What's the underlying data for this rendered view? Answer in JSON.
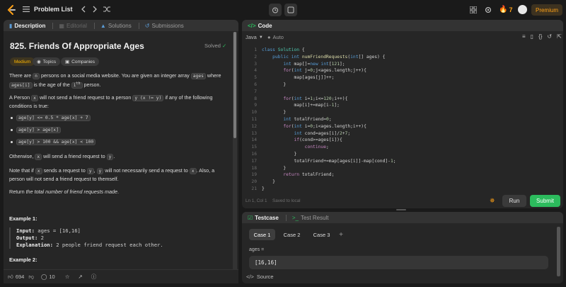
{
  "header": {
    "problem_list": "Problem List",
    "streak": "7",
    "premium": "Premium"
  },
  "left_tabs": {
    "description": "Description",
    "editorial": "Editorial",
    "solutions": "Solutions",
    "submissions": "Submissions"
  },
  "problem": {
    "title": "825. Friends Of Appropriate Ages",
    "solved": "Solved",
    "tags": {
      "difficulty": "Medium",
      "topics": "Topics",
      "companies": "Companies"
    },
    "p1": {
      "a": "There are",
      "n": "n",
      "b": "persons on a social media website. You are given an integer array",
      "ages": "ages",
      "c": "where",
      "agesi": "ages[i]",
      "d": "is the age of the",
      "sup_i": "i",
      "sup_th": "th",
      "e": "person."
    },
    "p2": {
      "a": "A Person",
      "x": "x",
      "b": "will not send a friend request to a person",
      "cond": "y (x != y)",
      "c": "if any of the following conditions is true:"
    },
    "conditions": [
      "age[y] <= 0.5 * age[x] + 7",
      "age[y] > age[x]",
      "age[y] > 100 && age[x] < 100"
    ],
    "p3": {
      "a": "Otherwise,",
      "x": "x",
      "b": "will send a friend request to",
      "y": "y",
      "c": "."
    },
    "p4": {
      "a": "Note that if",
      "x": "x",
      "b": "sends a request to",
      "y": "y",
      "c": ",",
      "y2": "y",
      "d": "will not necessarily send a request to",
      "x2": "x",
      "e": ". Also, a person will not send a friend request to themself."
    },
    "p5": {
      "a": "Return",
      "b": "the total number of friend requests made",
      "c": "."
    },
    "example1": {
      "head": "Example 1:",
      "input_k": "Input:",
      "input_v": "ages = [16,16]",
      "output_k": "Output:",
      "output_v": "2",
      "expl_k": "Explanation:",
      "expl_v": "2 people friend request each other."
    },
    "example2": {
      "head": "Example 2:"
    }
  },
  "left_footer": {
    "likes": "694",
    "comments": "10"
  },
  "code": {
    "tab": "Code",
    "lang": "Java",
    "auto": "Auto",
    "status_pos": "Ln 1, Col 1",
    "status_saved": "Saved to local",
    "run": "Run",
    "submit": "Submit",
    "lines": [
      "1",
      "2",
      "3",
      "4",
      "5",
      "6",
      "7",
      "8",
      "9",
      "10",
      "11",
      "12",
      "13",
      "14",
      "15",
      "16",
      "17",
      "18",
      "19",
      "20",
      "21"
    ]
  },
  "testcase": {
    "tab": "Testcase",
    "result_tab": "Test Result",
    "cases": [
      "Case 1",
      "Case 2",
      "Case 3"
    ],
    "plus": "+",
    "param": "ages =",
    "value": "[16,16]",
    "source": "Source"
  },
  "colors": {
    "accent": "#ffa116",
    "submit": "#2cbb5d",
    "solved": "#2cbb5d",
    "medium": "#ffb800"
  }
}
